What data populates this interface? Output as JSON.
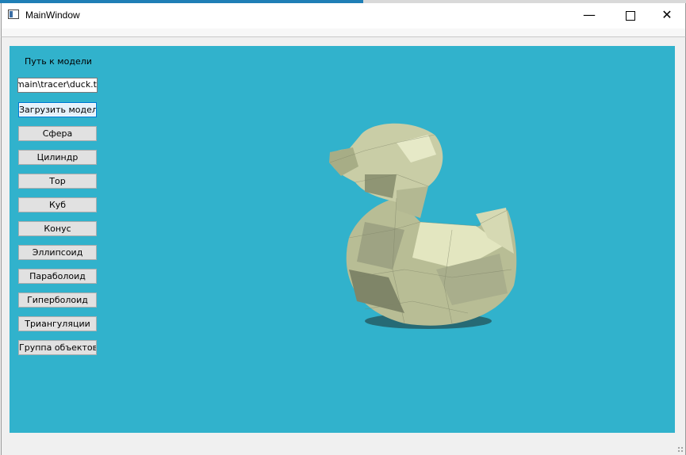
{
  "window": {
    "title": "MainWindow",
    "controls": {
      "minimize": "—",
      "maximize": "",
      "close": "✕"
    }
  },
  "panel": {
    "path_label": "Путь  к модели",
    "path_value": "y-main\\tracer\\duck.t",
    "load_button": "Загрузить модель",
    "buttons": [
      "Сфера",
      "Цилиндр",
      "Тор",
      "Куб",
      "Конус",
      "Эллипсоид",
      "Параболоид",
      "Гиперболоид",
      "Триангуляции",
      "Группа объектов"
    ]
  },
  "viewport": {
    "background_color": "#31b2cc",
    "model": "duck",
    "model_color": "#dfe3b8"
  }
}
